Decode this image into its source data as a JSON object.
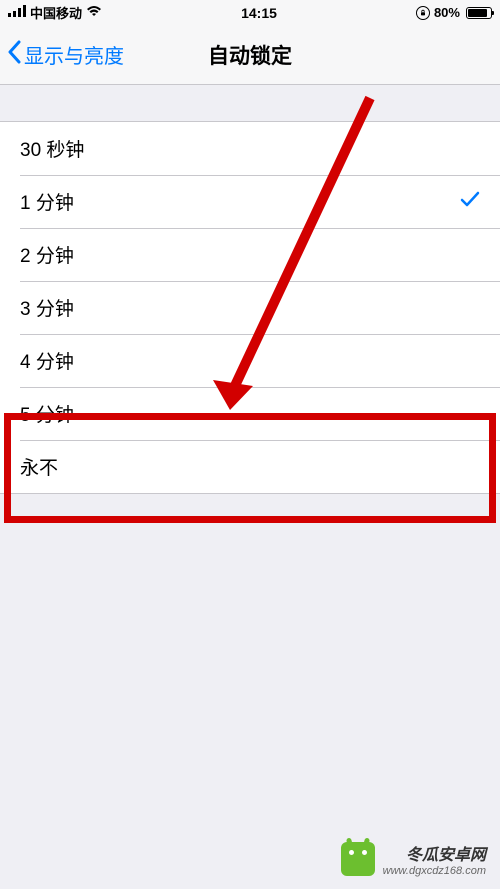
{
  "statusbar": {
    "carrier": "中国移动",
    "time": "14:15",
    "battery_percent": "80%"
  },
  "nav": {
    "back_label": "显示与亮度",
    "title": "自动锁定"
  },
  "options": [
    {
      "label": "30 秒钟",
      "selected": false
    },
    {
      "label": "1 分钟",
      "selected": true
    },
    {
      "label": "2 分钟",
      "selected": false
    },
    {
      "label": "3 分钟",
      "selected": false
    },
    {
      "label": "4 分钟",
      "selected": false
    },
    {
      "label": "5 分钟",
      "selected": false
    },
    {
      "label": "永不",
      "selected": false
    }
  ],
  "watermark": {
    "name": "冬瓜安卓网",
    "url": "www.dgxcdz168.com"
  }
}
